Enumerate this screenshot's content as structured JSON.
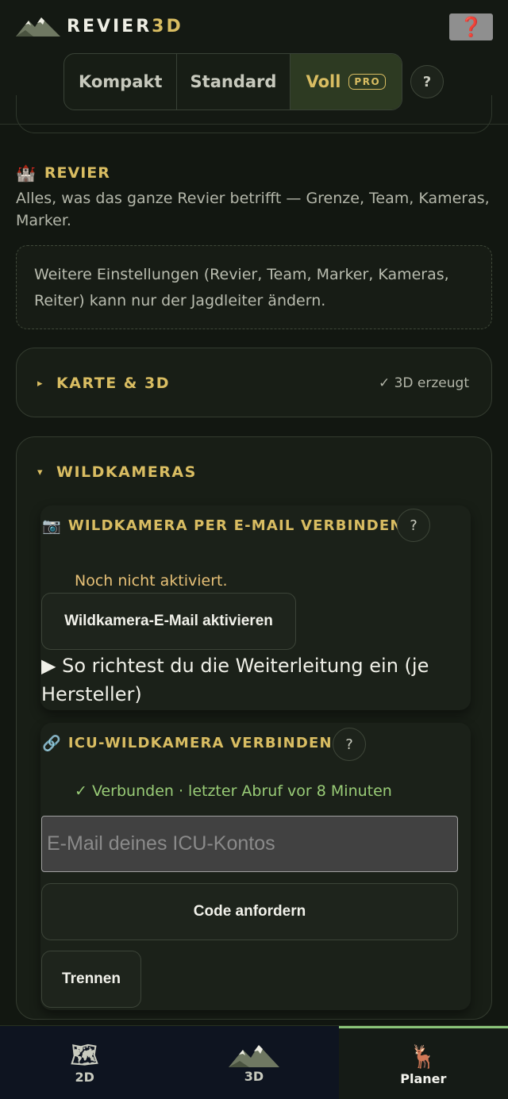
{
  "header": {
    "brand_prefix": "REVIER",
    "brand_suffix": "3D",
    "help_symbol": "❓",
    "view_modes": [
      {
        "label": "Kompakt",
        "selected": false
      },
      {
        "label": "Standard",
        "selected": false
      },
      {
        "label": "Voll",
        "selected": true,
        "badge": "PRO"
      }
    ],
    "info_button": "?"
  },
  "revier": {
    "icon": "🏰",
    "title": "REVIER",
    "description": "Alles, was das ganze Revier betrifft — Grenze, Team, Kameras, Marker.",
    "notice": "Weitere Einstellungen (Revier, Team, Marker, Kameras, Reiter) kann nur der Jagdleiter ändern."
  },
  "karte": {
    "toggle": "▸",
    "title": "KARTE & 3D",
    "status": "✓ 3D erzeugt"
  },
  "wildkameras": {
    "toggle": "▾",
    "title": "WILDKAMERAS",
    "email_block": {
      "icon": "📷",
      "title": "WILDKAMERA PER E-MAIL VERBINDEN",
      "help": "?",
      "status": "Noch nicht aktiviert.",
      "activate_button": "Wildkamera-E-Mail aktivieren",
      "howto": "▶ So richtest du die Weiterleitung ein (je Hersteller)"
    },
    "icu_block": {
      "icon": "🔗",
      "title": "ICU-WILDKAMERA VERBINDEN",
      "help": "?",
      "status": "✓ Verbunden · letzter Abruf vor 8 Minuten",
      "email_placeholder": "E-Mail deines ICU-Kontos",
      "code_button": "Code anfordern",
      "disconnect_button": "Trennen"
    }
  },
  "nav": {
    "items": [
      {
        "label": "2D",
        "icon": "map-icon",
        "active": false
      },
      {
        "label": "3D",
        "icon": "mountain-icon",
        "active": false
      },
      {
        "label": "Planer",
        "icon": "deer-icon",
        "active": true
      }
    ]
  },
  "colors": {
    "background": "#121711",
    "accent_gold": "#d9bd62",
    "success_green": "#99cc77",
    "warning_amber": "#e6c077",
    "active_nav_border": "#8bc47a"
  }
}
